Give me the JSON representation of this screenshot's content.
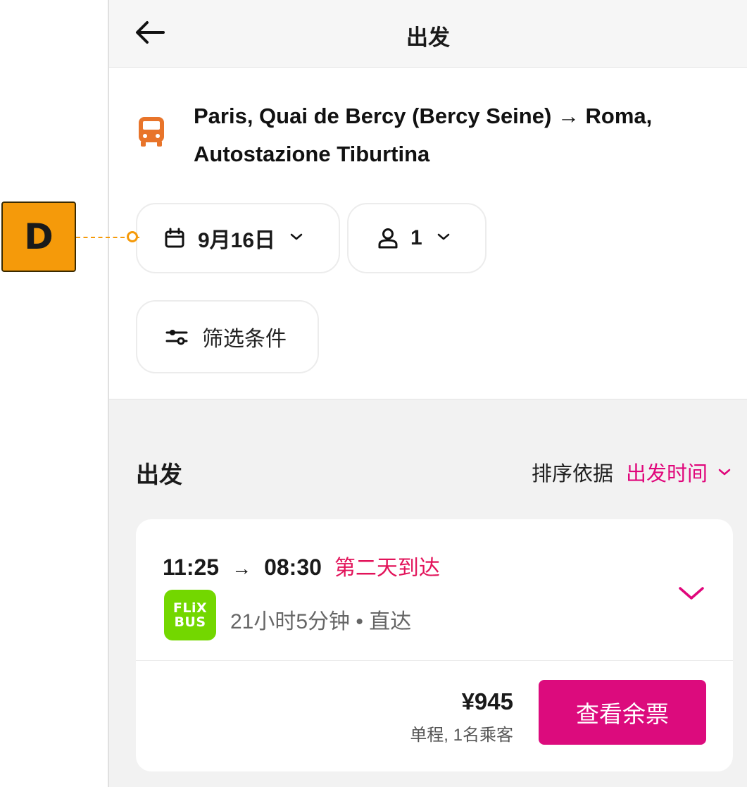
{
  "header": {
    "title": "出发",
    "back_icon": "arrow-left-icon"
  },
  "route": {
    "icon": "bus-icon",
    "icon_color": "#e8742a",
    "text": "Paris, Quai de Bercy (Bercy Seine) → Roma, Autostazione Tiburtina"
  },
  "filters": {
    "date_label": "9月16日",
    "date_icon": "calendar-icon",
    "passengers_label": "1",
    "passengers_icon": "person-icon",
    "filter_label": "筛选条件",
    "filter_icon": "sliders-icon"
  },
  "results": {
    "section_title": "出发",
    "sort_label": "排序依据",
    "sort_value": "出发时间",
    "accent_color": "#e0067b"
  },
  "trip": {
    "depart": "11:25",
    "arrow": "→",
    "arrive": "08:30",
    "next_day": "第二天到达",
    "operator_logo_line1": "FLiX",
    "operator_logo_line2": "BUS",
    "operator_color": "#73d700",
    "duration_info": "21小时5分钟 • 直达",
    "price": "¥945",
    "price_note": "单程, 1名乘客",
    "cta_label": "查看余票",
    "cta_color": "#dc0b7d"
  },
  "annotation": {
    "marker_label": "D"
  }
}
